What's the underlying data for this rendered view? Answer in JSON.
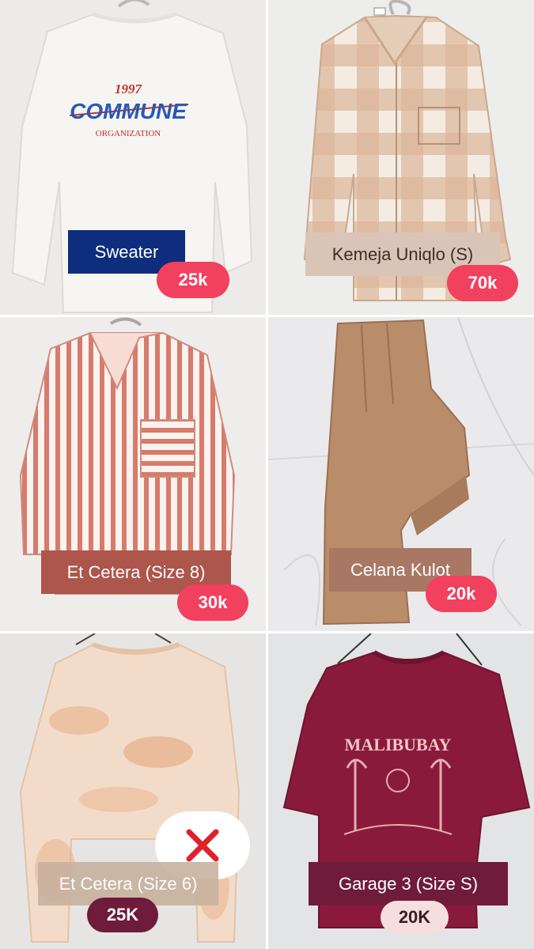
{
  "items": [
    {
      "label": "Sweater",
      "price": "25k",
      "label_bg": "#0e2d7d",
      "label_color": "#ffffff",
      "price_bg": "#f2405f",
      "price_color": "#ffffff"
    },
    {
      "label": "Kemeja Uniqlo (S)",
      "price": "70k",
      "label_bg": "#d9c5b8",
      "label_color": "#3b2f2c",
      "price_bg": "#f2405f",
      "price_color": "#ffffff"
    },
    {
      "label": "Et Cetera (Size 8)",
      "price": "30k",
      "label_bg": "#ad564c",
      "label_color": "#ffffff",
      "price_bg": "#f2405f",
      "price_color": "#ffffff"
    },
    {
      "label": "Celana Kulot",
      "price": "20k",
      "label_bg": "#a97865",
      "label_color": "#ffffff",
      "price_bg": "#f2405f",
      "price_color": "#ffffff"
    },
    {
      "label": "Et Cetera (Size 6)",
      "price": "25K",
      "label_bg": "#c8b29e",
      "label_color": "#ffffff",
      "price_bg": "#6e1b3c",
      "price_color": "#ffffff",
      "sold": true,
      "sold_icon": "cross-mark-icon"
    },
    {
      "label": "Garage 3 (Size S)",
      "price": "20K",
      "label_bg": "#6f1c3b",
      "label_color": "#ffffff",
      "price_bg": "#f6dede",
      "price_color": "#3a1b25"
    }
  ],
  "graphics": {
    "sweater_print": {
      "year": "1997",
      "brand": "COMMUNE",
      "sub": "ORGANIZATION"
    },
    "tshirt_print": {
      "text": "MALIBUBAY"
    }
  }
}
